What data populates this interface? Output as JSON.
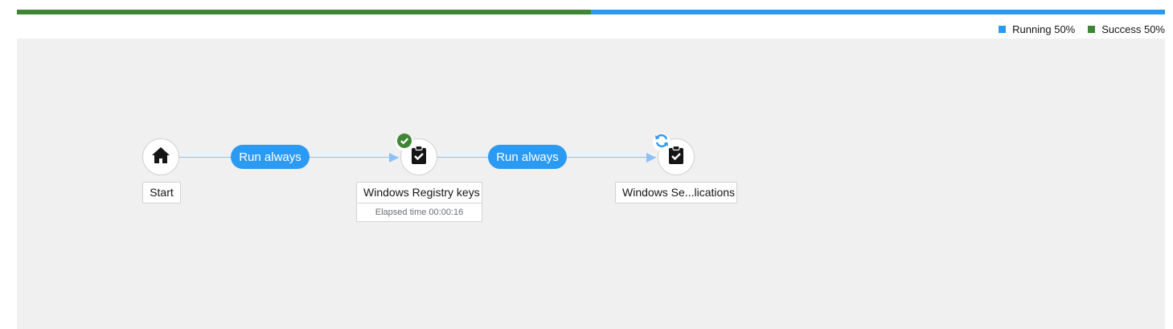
{
  "progress": {
    "segments": [
      {
        "name": "Success",
        "percent": 50,
        "color": "#3e8635"
      },
      {
        "name": "Running",
        "percent": 50,
        "color": "#2b9af3"
      }
    ]
  },
  "legend": {
    "items": [
      {
        "label": "Running 50%",
        "color": "#2b9af3"
      },
      {
        "label": "Success 50%",
        "color": "#3e8635"
      }
    ]
  },
  "graph": {
    "nodes": [
      {
        "id": "start",
        "label": "Start",
        "icon": "home-icon"
      },
      {
        "id": "registry",
        "label": "Windows Registry keys",
        "sub": "Elapsed time 00:00:16",
        "icon": "clipboard-check-icon",
        "status": "success",
        "status_icon": "check-circle-icon"
      },
      {
        "id": "services",
        "label": "Windows Se...lications",
        "icon": "clipboard-check-icon",
        "status": "running",
        "status_icon": "sync-icon"
      }
    ],
    "edges": [
      {
        "from": "start",
        "to": "registry",
        "label": "Run always"
      },
      {
        "from": "registry",
        "to": "services",
        "label": "Run always"
      }
    ]
  },
  "colors": {
    "success": "#3e8635",
    "running": "#2b9af3",
    "edge": "#8bc1f7",
    "canvas": "#f0f0f0"
  }
}
